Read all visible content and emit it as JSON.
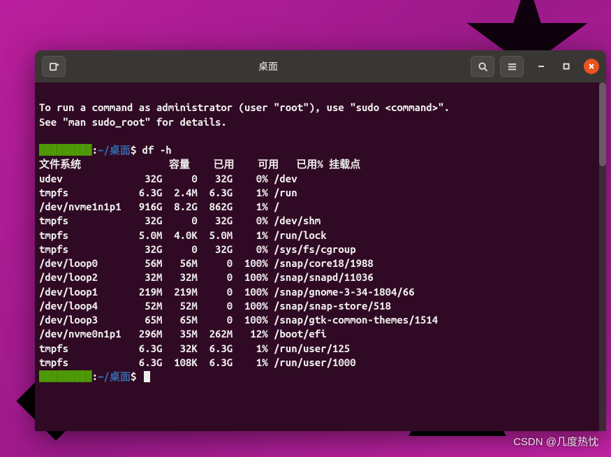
{
  "window": {
    "title": "桌面"
  },
  "intro": {
    "line1": "To run a command as administrator (user \"root\"), use \"sudo <command>\".",
    "line2": "See \"man sudo_root\" for details."
  },
  "prompt": {
    "user_host": "█████████",
    "path": "~/桌面",
    "command": "df -h"
  },
  "df": {
    "headers": {
      "fs": "文件系统",
      "size": "容量",
      "used": "已用",
      "avail": "可用",
      "usep": "已用%",
      "mount": "挂载点"
    },
    "rows": [
      {
        "fs": "udev",
        "size": "32G",
        "used": "0",
        "avail": "32G",
        "usep": "0%",
        "mount": "/dev"
      },
      {
        "fs": "tmpfs",
        "size": "6.3G",
        "used": "2.4M",
        "avail": "6.3G",
        "usep": "1%",
        "mount": "/run"
      },
      {
        "fs": "/dev/nvme1n1p1",
        "size": "916G",
        "used": "8.2G",
        "avail": "862G",
        "usep": "1%",
        "mount": "/"
      },
      {
        "fs": "tmpfs",
        "size": "32G",
        "used": "0",
        "avail": "32G",
        "usep": "0%",
        "mount": "/dev/shm"
      },
      {
        "fs": "tmpfs",
        "size": "5.0M",
        "used": "4.0K",
        "avail": "5.0M",
        "usep": "1%",
        "mount": "/run/lock"
      },
      {
        "fs": "tmpfs",
        "size": "32G",
        "used": "0",
        "avail": "32G",
        "usep": "0%",
        "mount": "/sys/fs/cgroup"
      },
      {
        "fs": "/dev/loop0",
        "size": "56M",
        "used": "56M",
        "avail": "0",
        "usep": "100%",
        "mount": "/snap/core18/1988"
      },
      {
        "fs": "/dev/loop2",
        "size": "32M",
        "used": "32M",
        "avail": "0",
        "usep": "100%",
        "mount": "/snap/snapd/11036"
      },
      {
        "fs": "/dev/loop1",
        "size": "219M",
        "used": "219M",
        "avail": "0",
        "usep": "100%",
        "mount": "/snap/gnome-3-34-1804/66"
      },
      {
        "fs": "/dev/loop4",
        "size": "52M",
        "used": "52M",
        "avail": "0",
        "usep": "100%",
        "mount": "/snap/snap-store/518"
      },
      {
        "fs": "/dev/loop3",
        "size": "65M",
        "used": "65M",
        "avail": "0",
        "usep": "100%",
        "mount": "/snap/gtk-common-themes/1514"
      },
      {
        "fs": "/dev/nvme0n1p1",
        "size": "296M",
        "used": "35M",
        "avail": "262M",
        "usep": "12%",
        "mount": "/boot/efi"
      },
      {
        "fs": "tmpfs",
        "size": "6.3G",
        "used": "32K",
        "avail": "6.3G",
        "usep": "1%",
        "mount": "/run/user/125"
      },
      {
        "fs": "tmpfs",
        "size": "6.3G",
        "used": "108K",
        "avail": "6.3G",
        "usep": "1%",
        "mount": "/run/user/1000"
      }
    ]
  },
  "prompt2": {
    "user_host": "█████████",
    "path": "~/桌面"
  },
  "watermark": "CSDN @几度热忱"
}
